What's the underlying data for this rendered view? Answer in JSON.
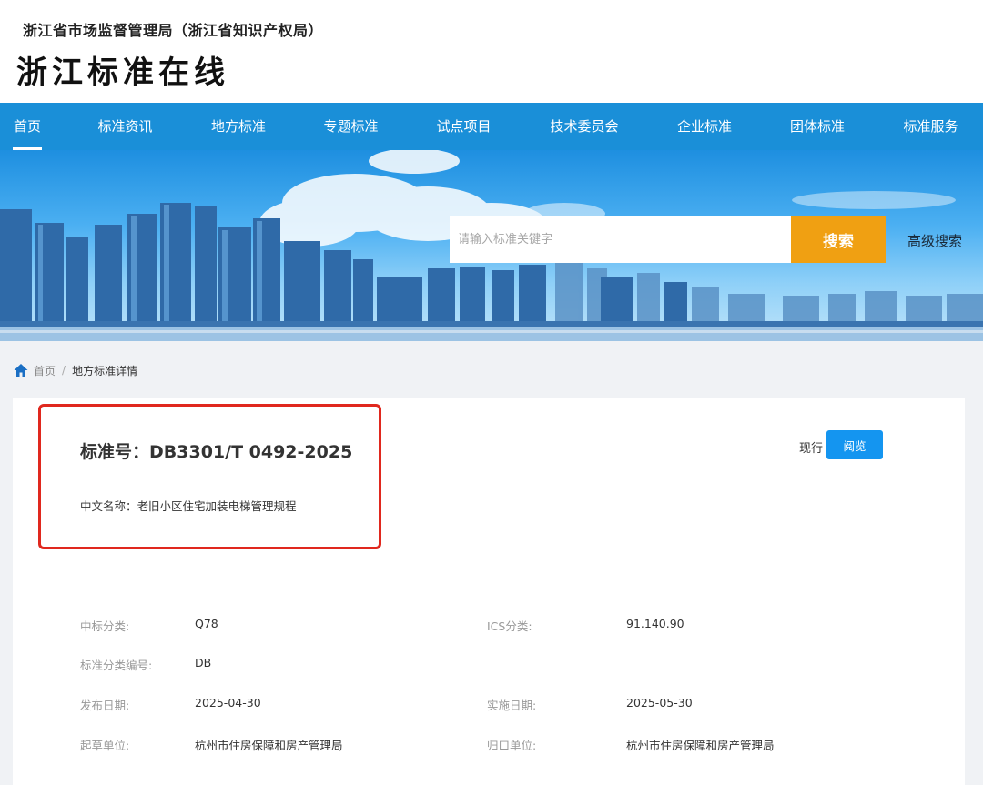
{
  "header": {
    "agency": "浙江省市场监督管理局（浙江省知识产权局）",
    "site_title": "浙江标准在线"
  },
  "nav": {
    "items": [
      {
        "label": "首页"
      },
      {
        "label": "标准资讯"
      },
      {
        "label": "地方标准"
      },
      {
        "label": "专题标准"
      },
      {
        "label": "试点项目"
      },
      {
        "label": "技术委员会"
      },
      {
        "label": "企业标准"
      },
      {
        "label": "团体标准"
      },
      {
        "label": "标准服务"
      }
    ],
    "active_index": 0
  },
  "search": {
    "placeholder": "请输入标准关键字",
    "button_label": "搜索",
    "advanced_label": "高级搜索"
  },
  "breadcrumb": {
    "home": "首页",
    "separator": "/",
    "current": "地方标准详情"
  },
  "detail": {
    "standard_number": "标准号：DB3301/T 0492-2025",
    "chinese_name": "中文名称：老旧小区住宅加装电梯管理规程",
    "status": "现行",
    "read_button": "阅览",
    "fields": [
      {
        "label": "中标分类:",
        "value": "Q78"
      },
      {
        "label": "ICS分类:",
        "value": "91.140.90"
      },
      {
        "label": "标准分类编号:",
        "value": "DB"
      },
      {
        "label": "发布日期:",
        "value": "2025-04-30"
      },
      {
        "label": "实施日期:",
        "value": "2025-05-30"
      },
      {
        "label": "起草单位:",
        "value": "杭州市住房保障和房产管理局"
      },
      {
        "label": "归口单位:",
        "value": "杭州市住房保障和房产管理局"
      }
    ]
  },
  "colors": {
    "nav_bg": "#1a8fd8",
    "search_button": "#f0a012",
    "read_button": "#1495f0",
    "highlight_border": "#e0281e"
  }
}
